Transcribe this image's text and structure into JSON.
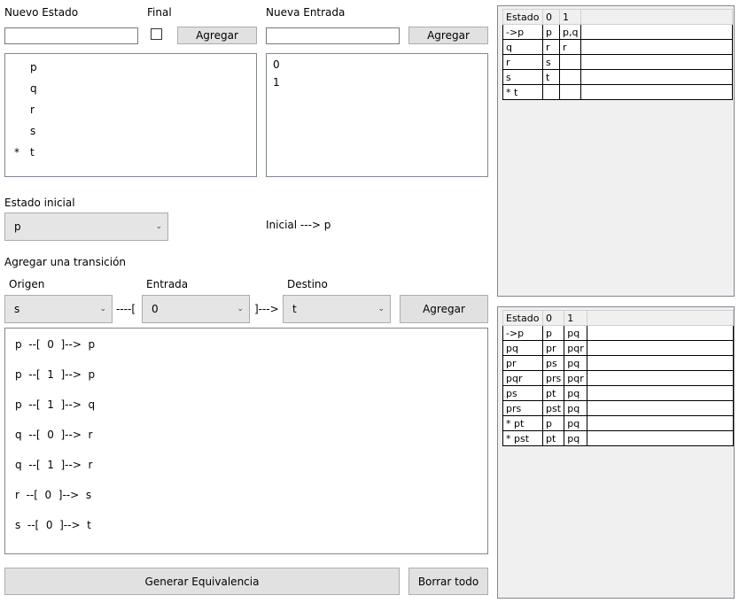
{
  "states_section": {
    "new_state_label": "Nuevo Estado",
    "final_label": "Final",
    "add_label": "Agregar",
    "states": [
      {
        "mark": "",
        "name": "p"
      },
      {
        "mark": "",
        "name": "q"
      },
      {
        "mark": "",
        "name": "r"
      },
      {
        "mark": "",
        "name": "s"
      },
      {
        "mark": "*",
        "name": "t"
      }
    ]
  },
  "inputs_section": {
    "new_input_label": "Nueva Entrada",
    "add_label": "Agregar",
    "inputs": [
      "0",
      "1"
    ]
  },
  "initial_section": {
    "label": "Estado inicial",
    "selected": "p",
    "display": "Inicial --->  p"
  },
  "transition_section": {
    "label": "Agregar una transición",
    "origin_label": "Origen",
    "input_label": "Entrada",
    "dest_label": "Destino",
    "origin_value": "s",
    "input_value": "0",
    "dest_value": "t",
    "sep1": "----[",
    "sep2": "]--->",
    "add_label": "Agregar",
    "transitions": [
      "p  --[  0  ]-->  p",
      "p  --[  1  ]-->  p",
      "p  --[  1  ]-->  q",
      "q  --[  0  ]-->  r",
      "q  --[  1  ]-->  r",
      "r  --[  0  ]-->  s",
      "s  --[  0  ]-->  t"
    ]
  },
  "footer": {
    "generate_label": "Generar Equivalencia",
    "clear_label": "Borrar todo"
  },
  "nfa_table": {
    "headers": [
      "Estado",
      "0",
      "1"
    ],
    "rows": [
      [
        "->p",
        "p",
        "p,q"
      ],
      [
        "q",
        "r",
        "r"
      ],
      [
        "r",
        "s",
        ""
      ],
      [
        "s",
        "t",
        ""
      ],
      [
        "* t",
        "",
        ""
      ]
    ]
  },
  "dfa_table": {
    "headers": [
      "Estado",
      "0",
      "1"
    ],
    "rows": [
      [
        "->p",
        "p",
        "pq"
      ],
      [
        "pq",
        "pr",
        "pqr"
      ],
      [
        "pr",
        "ps",
        "pq"
      ],
      [
        "pqr",
        "prs",
        "pqr"
      ],
      [
        "ps",
        "pt",
        "pq"
      ],
      [
        "prs",
        "pst",
        "pq"
      ],
      [
        "* pt",
        "p",
        "pq"
      ],
      [
        "* pst",
        "pt",
        "pq"
      ]
    ]
  }
}
